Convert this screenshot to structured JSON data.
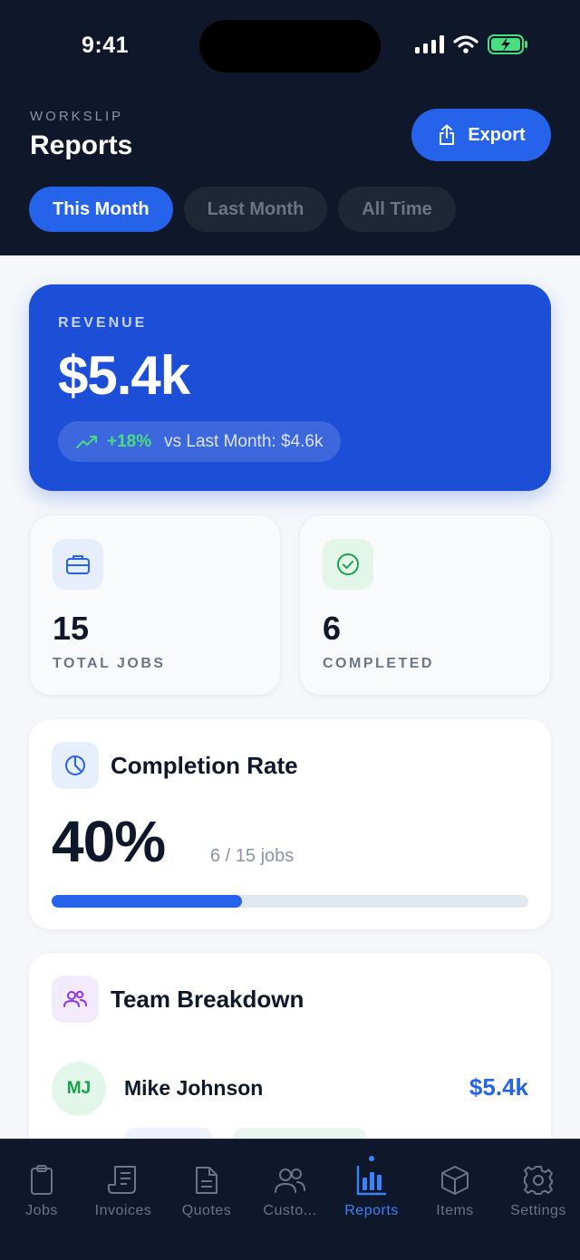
{
  "status": {
    "time": "9:41"
  },
  "header": {
    "kicker": "WORKSLIP",
    "title": "Reports",
    "export_label": "Export",
    "periods": [
      "This Month",
      "Last Month",
      "All Time"
    ],
    "active_period": "This Month"
  },
  "revenue": {
    "label": "REVENUE",
    "value": "$5.4k",
    "change_pct": "+18%",
    "compare_text": "vs Last Month: $4.6k"
  },
  "stats": {
    "total_jobs": {
      "value": "15",
      "label": "TOTAL JOBS"
    },
    "completed": {
      "value": "6",
      "label": "COMPLETED"
    }
  },
  "completion": {
    "title": "Completion Rate",
    "value": "40%",
    "detail": "6 / 15 jobs",
    "progress_fraction": 0.4
  },
  "team": {
    "title": "Team Breakdown",
    "members": [
      {
        "initials": "MJ",
        "name": "Mike Johnson",
        "amount": "$5.4k"
      }
    ]
  },
  "tabs": [
    {
      "label": "Jobs",
      "icon": "clipboard-icon"
    },
    {
      "label": "Invoices",
      "icon": "invoice-icon"
    },
    {
      "label": "Quotes",
      "icon": "document-icon"
    },
    {
      "label": "Custo...",
      "icon": "customers-icon"
    },
    {
      "label": "Reports",
      "icon": "bar-chart-icon",
      "active": true
    },
    {
      "label": "Items",
      "icon": "box-icon"
    },
    {
      "label": "Settings",
      "icon": "gear-icon"
    }
  ],
  "colors": {
    "header_bg": "#0f172a",
    "accent": "#2563eb",
    "revenue_card": "#1d4ed8",
    "positive": "#4ade80",
    "battery": "#4ade80"
  }
}
